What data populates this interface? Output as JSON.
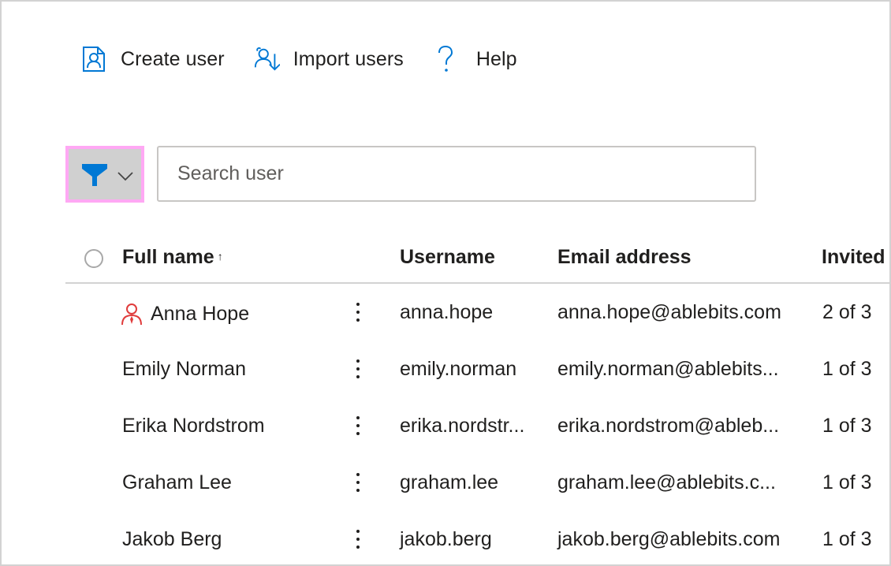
{
  "commandbar": {
    "create_user": {
      "label": "Create user",
      "icon": "create-user-icon"
    },
    "import_users": {
      "label": "Import users",
      "icon": "import-users-icon"
    },
    "help": {
      "label": "Help",
      "icon": "help-icon"
    }
  },
  "filter": {
    "icon": "filter-icon",
    "dropdown_icon": "chevron-down-icon"
  },
  "search": {
    "placeholder": "Search user",
    "value": ""
  },
  "colors": {
    "accent": "#0078d4",
    "admin_icon": "#e03c3c",
    "filter_highlight": "#ffa8f4"
  },
  "table": {
    "columns": [
      {
        "label": "Full name",
        "sort": "ascending",
        "sort_glyph": "↑"
      },
      {
        "label": "Username"
      },
      {
        "label": "Email address"
      },
      {
        "label": "Invited"
      }
    ],
    "rows": [
      {
        "full_name": "Anna Hope",
        "role_icon": "admin-user-icon",
        "username": "anna.hope",
        "email": "anna.hope@ablebits.com",
        "invited": "2 of 3"
      },
      {
        "full_name": "Emily Norman",
        "username": "emily.norman",
        "email": "emily.norman@ablebits...",
        "invited": "1 of 3"
      },
      {
        "full_name": "Erika Nordstrom",
        "username": "erika.nordstr...",
        "email": "erika.nordstrom@ableb...",
        "invited": "1 of 3"
      },
      {
        "full_name": "Graham Lee",
        "username": "graham.lee",
        "email": "graham.lee@ablebits.c...",
        "invited": "1 of 3"
      },
      {
        "full_name": "Jakob Berg",
        "username": "jakob.berg",
        "email": "jakob.berg@ablebits.com",
        "invited": "1 of 3"
      }
    ]
  }
}
